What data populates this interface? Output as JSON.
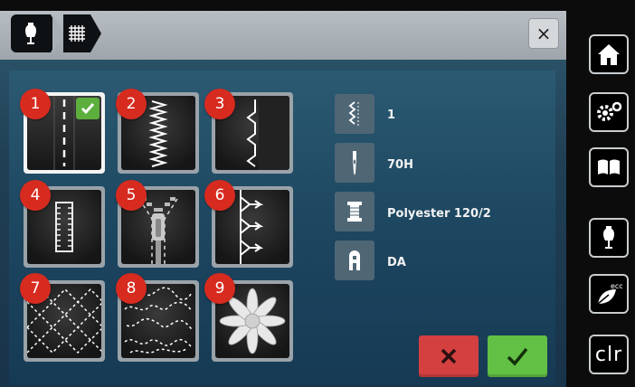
{
  "header": {
    "crumbs": [
      {
        "icon": "dress-form-icon"
      },
      {
        "icon": "grid-pattern-icon"
      }
    ],
    "close_icon": "close-icon",
    "close_label": "×"
  },
  "stitches": [
    {
      "number": "1",
      "icon": "straight-stitch-icon",
      "selected": true
    },
    {
      "number": "2",
      "icon": "zigzag-stitch-icon",
      "selected": false
    },
    {
      "number": "3",
      "icon": "blind-stitch-icon",
      "selected": false
    },
    {
      "number": "4",
      "icon": "buttonhole-icon",
      "selected": false
    },
    {
      "number": "5",
      "icon": "zipper-icon",
      "selected": false
    },
    {
      "number": "6",
      "icon": "decorative-stitch-icon",
      "selected": false
    },
    {
      "number": "7",
      "icon": "quilt-pattern-icon",
      "selected": false
    },
    {
      "number": "8",
      "icon": "stipple-pattern-icon",
      "selected": false
    },
    {
      "number": "9",
      "icon": "flower-motif-icon",
      "selected": false
    }
  ],
  "info": [
    {
      "icon": "presser-foot-icon",
      "value": "1"
    },
    {
      "icon": "needle-icon",
      "value": "70H"
    },
    {
      "icon": "thread-spool-icon",
      "value": "Polyester 120/2"
    },
    {
      "icon": "feed-dog-icon",
      "value": "DA"
    }
  ],
  "actions": {
    "cancel_icon": "cancel-x-icon",
    "confirm_icon": "confirm-check-icon"
  },
  "sidebar": [
    {
      "name": "home",
      "icon": "home-icon"
    },
    {
      "name": "settings",
      "icon": "settings-gears-icon"
    },
    {
      "name": "guide",
      "icon": "book-icon"
    },
    {
      "name": "sewing-consultant",
      "icon": "dress-form-icon"
    },
    {
      "name": "eco",
      "icon": "eco-leaf-icon",
      "label": "eco"
    },
    {
      "name": "clr",
      "icon": "",
      "label": "clr"
    }
  ],
  "colors": {
    "badge": "#d72b20",
    "check": "#5cae3d",
    "cancel": "#d44040",
    "confirm": "#62c044"
  }
}
